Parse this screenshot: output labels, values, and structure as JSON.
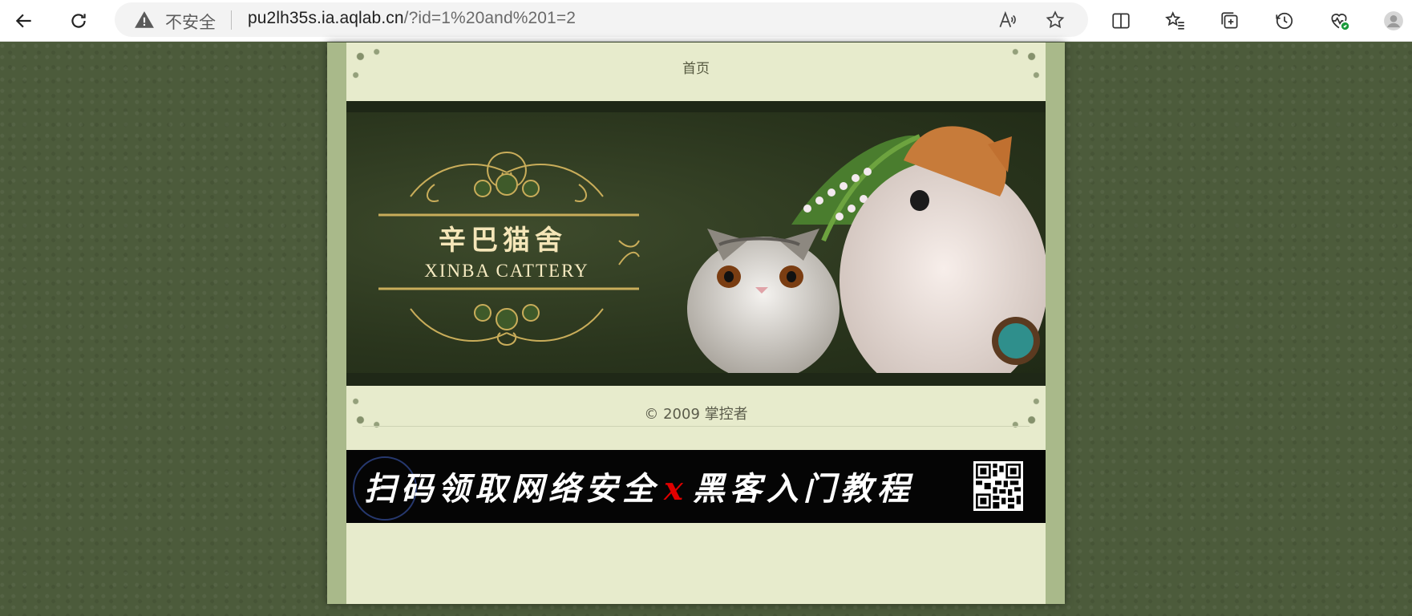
{
  "browser": {
    "address": {
      "security_label": "不安全",
      "url_host": "pu2lh35s.ia.aqlab.cn",
      "url_rest": "/?id=1%20and%201=2"
    },
    "icons": [
      "back-icon",
      "refresh-icon",
      "warning-icon",
      "read-aloud-icon",
      "favorite-icon",
      "split-screen-icon",
      "favorites-list-icon",
      "collections-icon",
      "history-icon",
      "browser-essentials-icon",
      "profile-icon"
    ]
  },
  "page": {
    "nav": {
      "home": "首页"
    },
    "banner": {
      "title_cn": "辛巴猫舍",
      "title_en": "XINBA CATTERY"
    },
    "footer": {
      "copyright": "© 2009 掌控者"
    },
    "ad": {
      "text_left": "扫码领取网络安全",
      "separator": "x",
      "text_right": "黑客入门教程"
    }
  },
  "colors": {
    "page_bg": "#4c5b3b",
    "frame": "#a9b98a",
    "inner": "#e7ebcc",
    "banner_bg": "#27321c",
    "ad_bg": "#050505",
    "ad_accent": "#e00000"
  }
}
